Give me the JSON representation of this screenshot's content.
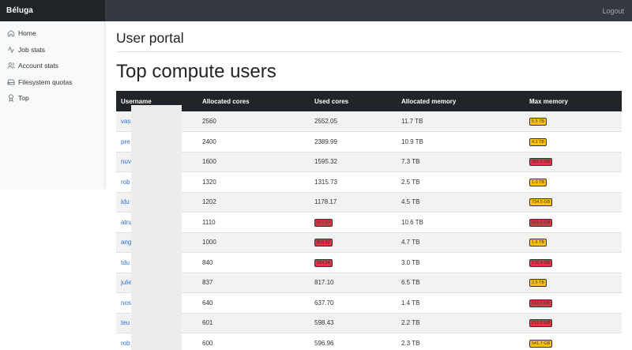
{
  "brand": "Béluga",
  "logout": "Logout",
  "sidebar": {
    "items": [
      {
        "label": "Home",
        "icon": "home-icon"
      },
      {
        "label": "Job stats",
        "icon": "activity-icon"
      },
      {
        "label": "Account stats",
        "icon": "users-icon"
      },
      {
        "label": "Filesystem quotas",
        "icon": "hard-drive-icon"
      },
      {
        "label": "Top",
        "icon": "award-icon"
      }
    ]
  },
  "main": {
    "portal_title": "User portal",
    "page_title": "Top compute users"
  },
  "table": {
    "headers": [
      "Username",
      "Allocated cores",
      "Used cores",
      "Allocated memory",
      "Max memory"
    ],
    "rows": [
      {
        "username": "vas",
        "alloc_cores": "2560",
        "used_cores": "2552.05",
        "used_flag": "",
        "alloc_mem": "11.7 TB",
        "max_mem": "5.5 TB",
        "mem_flag": "yellow"
      },
      {
        "username": "pre",
        "alloc_cores": "2400",
        "used_cores": "2389.99",
        "used_flag": "",
        "alloc_mem": "10.9 TB",
        "max_mem": "4.1 TB",
        "mem_flag": "yellow"
      },
      {
        "username": "nuv",
        "alloc_cores": "1600",
        "used_cores": "1595.32",
        "used_flag": "",
        "alloc_mem": "7.3 TB",
        "max_mem": "259.2 GB",
        "mem_flag": "red"
      },
      {
        "username": "rob",
        "alloc_cores": "1320",
        "used_cores": "1315.73",
        "used_flag": "",
        "alloc_mem": "2.5 TB",
        "max_mem": "1.0 TB",
        "mem_flag": "yellow"
      },
      {
        "username": "ldu",
        "alloc_cores": "1202",
        "used_cores": "1178.17",
        "used_flag": "",
        "alloc_mem": "4.5 TB",
        "max_mem": "734.5 GB",
        "mem_flag": "yellow"
      },
      {
        "username": "atru",
        "alloc_cores": "1110",
        "used_cores": "977.17",
        "used_flag": "red",
        "alloc_mem": "10.6 TB",
        "max_mem": "923.6 GB",
        "mem_flag": "red"
      },
      {
        "username": "ang",
        "alloc_cores": "1000",
        "used_cores": "810.52",
        "used_flag": "red",
        "alloc_mem": "4.7 TB",
        "max_mem": "1.6 TB",
        "mem_flag": "yellow"
      },
      {
        "username": "tdu",
        "alloc_cores": "840",
        "used_cores": "224.24",
        "used_flag": "red",
        "alloc_mem": "3.0 TB",
        "max_mem": "176.4 GB",
        "mem_flag": "red"
      },
      {
        "username": "julie",
        "alloc_cores": "837",
        "used_cores": "817.10",
        "used_flag": "",
        "alloc_mem": "6.5 TB",
        "max_mem": "2.5 TB",
        "mem_flag": "yellow"
      },
      {
        "username": "nos",
        "alloc_cores": "640",
        "used_cores": "637.70",
        "used_flag": "",
        "alloc_mem": "1.4 TB",
        "max_mem": "113.1 GB",
        "mem_flag": "red"
      },
      {
        "username": "teu",
        "alloc_cores": "601",
        "used_cores": "598.43",
        "used_flag": "",
        "alloc_mem": "2.2 TB",
        "max_mem": "213.2 GB",
        "mem_flag": "red"
      },
      {
        "username": "rob",
        "alloc_cores": "600",
        "used_cores": "596.96",
        "used_flag": "",
        "alloc_mem": "2.3 TB",
        "max_mem": "541.7 GB",
        "mem_flag": "yellow"
      }
    ]
  },
  "colors": {
    "navbar": "#343a40",
    "brand_bg": "#212529",
    "link": "#2f6fe0",
    "badge_red": "#dc3545",
    "badge_yellow": "#ffc107"
  }
}
